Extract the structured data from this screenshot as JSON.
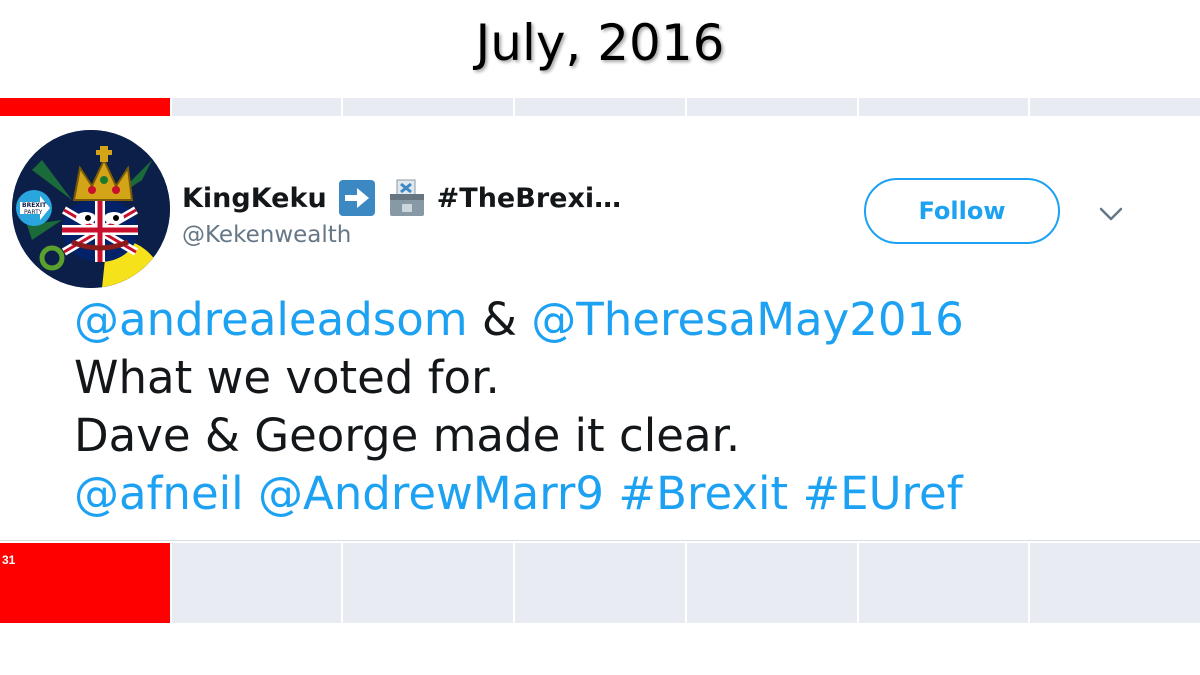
{
  "slide": {
    "title": "July, 2016"
  },
  "calendar": {
    "visible_day": "31",
    "highlight_color": "#ff0000",
    "cell_color": "#e8ecf2"
  },
  "tweet": {
    "display_name": "KingKeku",
    "display_name_tail": "#TheBrexi…",
    "handle": "@Kekenwealth",
    "emoji": [
      "right-arrow-emoji",
      "ballot-box-emoji"
    ],
    "avatar": {
      "badge_line1": "BREXIT",
      "badge_line2": "PARTY"
    },
    "follow_label": "Follow",
    "menu_icon": "chevron-down-icon",
    "accent_color": "#1da1f2",
    "text": {
      "mention1": "@andrealeadsom",
      "amp": "&",
      "mention2": "@TheresaMay2016",
      "line2": "What we voted for.",
      "line3": "Dave & George made it clear.",
      "mention3": "@afneil",
      "mention4": "@AndrewMarr9",
      "hashtag1": "#Brexit",
      "hashtag2": "#EUref"
    }
  }
}
